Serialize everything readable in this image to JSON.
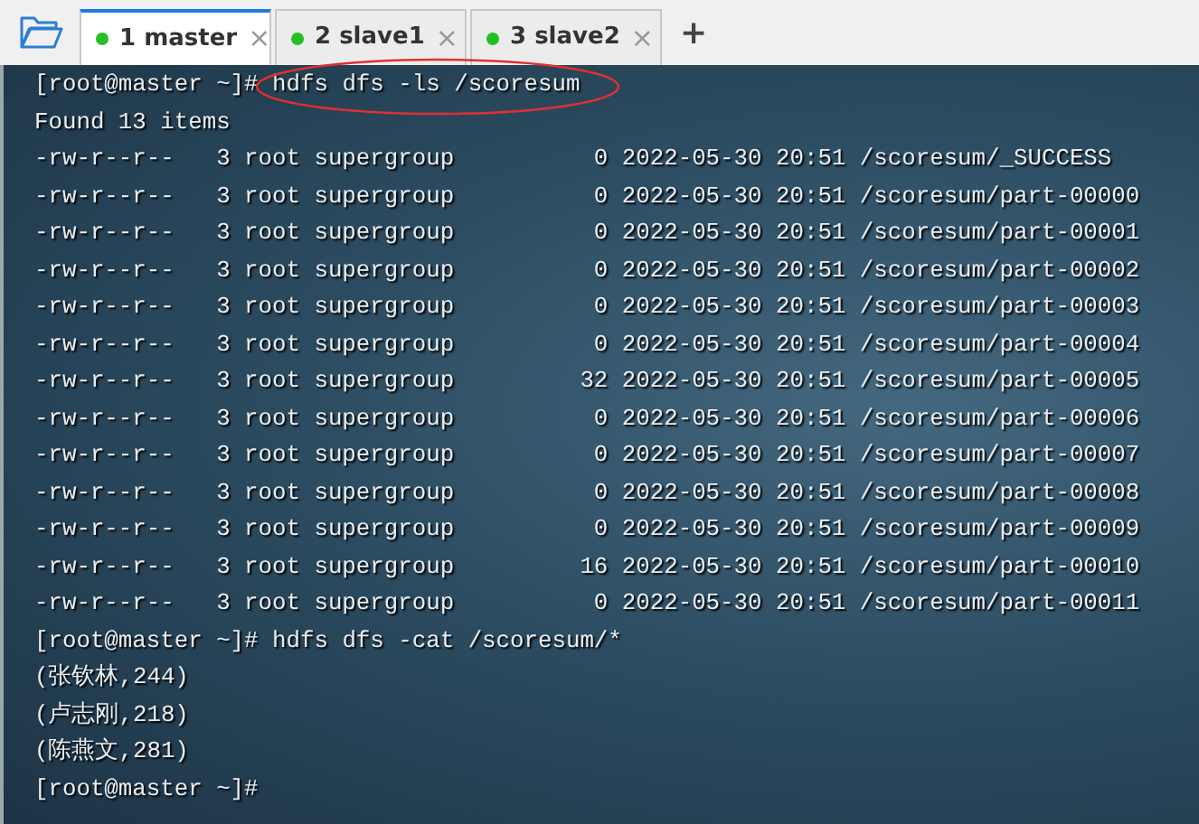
{
  "tabs": [
    {
      "number": "1",
      "label": "master",
      "selected": true,
      "close": "×",
      "color": "#22c022"
    },
    {
      "number": "2",
      "label": "slave1",
      "selected": false,
      "close": "×",
      "color": "#22c022"
    },
    {
      "number": "3",
      "label": "slave2",
      "selected": false,
      "close": "×",
      "color": "#22c022"
    }
  ],
  "new_tab": "+",
  "terminal": {
    "lines": [
      {
        "kind": "prompt",
        "prompt": "[root@master ~]#",
        "command": "hdfs dfs -ls /scoresum",
        "circled": true
      },
      {
        "kind": "output",
        "text": "Found 13 items"
      },
      {
        "kind": "output",
        "text": "-rw-r--r--   3 root supergroup          0 2022-05-30 20:51 /scoresum/_SUCCESS"
      },
      {
        "kind": "output",
        "text": "-rw-r--r--   3 root supergroup          0 2022-05-30 20:51 /scoresum/part-00000"
      },
      {
        "kind": "output",
        "text": "-rw-r--r--   3 root supergroup          0 2022-05-30 20:51 /scoresum/part-00001"
      },
      {
        "kind": "output",
        "text": "-rw-r--r--   3 root supergroup          0 2022-05-30 20:51 /scoresum/part-00002"
      },
      {
        "kind": "output",
        "text": "-rw-r--r--   3 root supergroup          0 2022-05-30 20:51 /scoresum/part-00003"
      },
      {
        "kind": "output",
        "text": "-rw-r--r--   3 root supergroup          0 2022-05-30 20:51 /scoresum/part-00004"
      },
      {
        "kind": "output",
        "text": "-rw-r--r--   3 root supergroup         32 2022-05-30 20:51 /scoresum/part-00005"
      },
      {
        "kind": "output",
        "text": "-rw-r--r--   3 root supergroup          0 2022-05-30 20:51 /scoresum/part-00006"
      },
      {
        "kind": "output",
        "text": "-rw-r--r--   3 root supergroup          0 2022-05-30 20:51 /scoresum/part-00007"
      },
      {
        "kind": "output",
        "text": "-rw-r--r--   3 root supergroup          0 2022-05-30 20:51 /scoresum/part-00008"
      },
      {
        "kind": "output",
        "text": "-rw-r--r--   3 root supergroup          0 2022-05-30 20:51 /scoresum/part-00009"
      },
      {
        "kind": "output",
        "text": "-rw-r--r--   3 root supergroup         16 2022-05-30 20:51 /scoresum/part-00010"
      },
      {
        "kind": "output",
        "text": "-rw-r--r--   3 root supergroup          0 2022-05-30 20:51 /scoresum/part-00011"
      },
      {
        "kind": "prompt",
        "prompt": "[root@master ~]#",
        "command": "hdfs dfs -cat /scoresum/*",
        "circled": false
      },
      {
        "kind": "output",
        "text": "(张钦林,244)"
      },
      {
        "kind": "output",
        "text": "(卢志刚,218)"
      },
      {
        "kind": "output",
        "text": "(陈燕文,281)"
      },
      {
        "kind": "prompt",
        "prompt": "[root@master ~]#",
        "circled": false
      }
    ]
  }
}
